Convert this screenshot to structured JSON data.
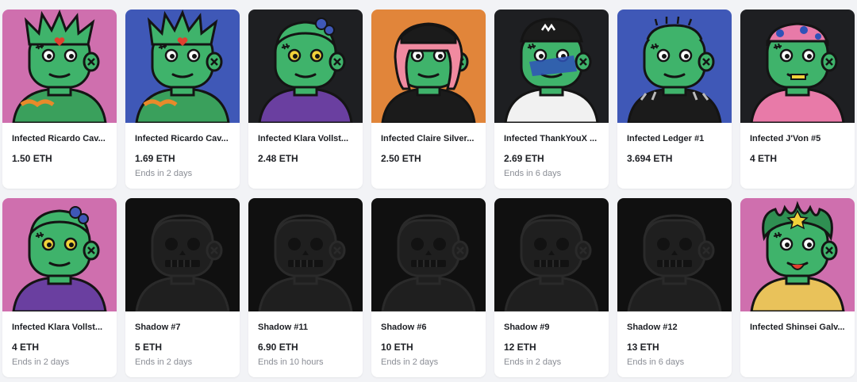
{
  "cards": [
    {
      "title": "Infected Ricardo Cav...",
      "price": "1.50 ETH",
      "ends": "",
      "bg": "#cf6fae",
      "skin": "#3fb36b",
      "kind": "spiky",
      "cloth": "#3aa05c"
    },
    {
      "title": "Infected Ricardo Cav...",
      "price": "1.69 ETH",
      "ends": "Ends in 2 days",
      "bg": "#3f58b7",
      "skin": "#3fb36b",
      "kind": "spiky",
      "cloth": "#3aa05c"
    },
    {
      "title": "Infected Klara Vollst...",
      "price": "2.48 ETH",
      "ends": "",
      "bg": "#1e1f22",
      "skin": "#3fb36b",
      "kind": "braids",
      "cloth": "#6a3fa0"
    },
    {
      "title": "Infected Claire Silver...",
      "price": "2.50 ETH",
      "ends": "",
      "bg": "#e1853a",
      "skin": "#3fb36b",
      "kind": "beanie",
      "cloth": "#1b1b1b"
    },
    {
      "title": "Infected ThankYouX ...",
      "price": "2.69 ETH",
      "ends": "Ends in 6 days",
      "bg": "#1e1f22",
      "skin": "#3fb36b",
      "kind": "cap",
      "cloth": "#f1f1f1"
    },
    {
      "title": "Infected Ledger #1",
      "price": "3.694 ETH",
      "ends": "",
      "bg": "#3f58b7",
      "skin": "#3fb36b",
      "kind": "cactus",
      "cloth": "#1b1b1b"
    },
    {
      "title": "Infected J'Von #5",
      "price": "4 ETH",
      "ends": "",
      "bg": "#1e1f22",
      "skin": "#3fb36b",
      "kind": "bandana",
      "cloth": "#e87aa8"
    },
    {
      "title": "Infected Klara Vollst...",
      "price": "4 ETH",
      "ends": "Ends in 2 days",
      "bg": "#cf6fae",
      "skin": "#3fb36b",
      "kind": "braids",
      "cloth": "#6a3fa0"
    },
    {
      "title": "Shadow #7",
      "price": "5 ETH",
      "ends": "Ends in 2 days",
      "bg": "#101010",
      "skin": "#1f1f1f",
      "kind": "shadow",
      "cloth": "#1f1f1f"
    },
    {
      "title": "Shadow #11",
      "price": "6.90 ETH",
      "ends": "Ends in 10 hours",
      "bg": "#101010",
      "skin": "#1f1f1f",
      "kind": "shadow",
      "cloth": "#1f1f1f"
    },
    {
      "title": "Shadow #6",
      "price": "10 ETH",
      "ends": "Ends in 2 days",
      "bg": "#101010",
      "skin": "#1f1f1f",
      "kind": "shadow",
      "cloth": "#1f1f1f"
    },
    {
      "title": "Shadow #9",
      "price": "12 ETH",
      "ends": "Ends in 2 days",
      "bg": "#101010",
      "skin": "#1f1f1f",
      "kind": "shadow",
      "cloth": "#1f1f1f"
    },
    {
      "title": "Shadow #12",
      "price": "13 ETH",
      "ends": "Ends in 6 days",
      "bg": "#101010",
      "skin": "#1f1f1f",
      "kind": "shadow",
      "cloth": "#1f1f1f"
    },
    {
      "title": "Infected Shinsei Galv...",
      "price": "",
      "ends": "",
      "bg": "#cf6fae",
      "skin": "#3fb36b",
      "kind": "leaves",
      "cloth": "#e9c25a"
    }
  ]
}
